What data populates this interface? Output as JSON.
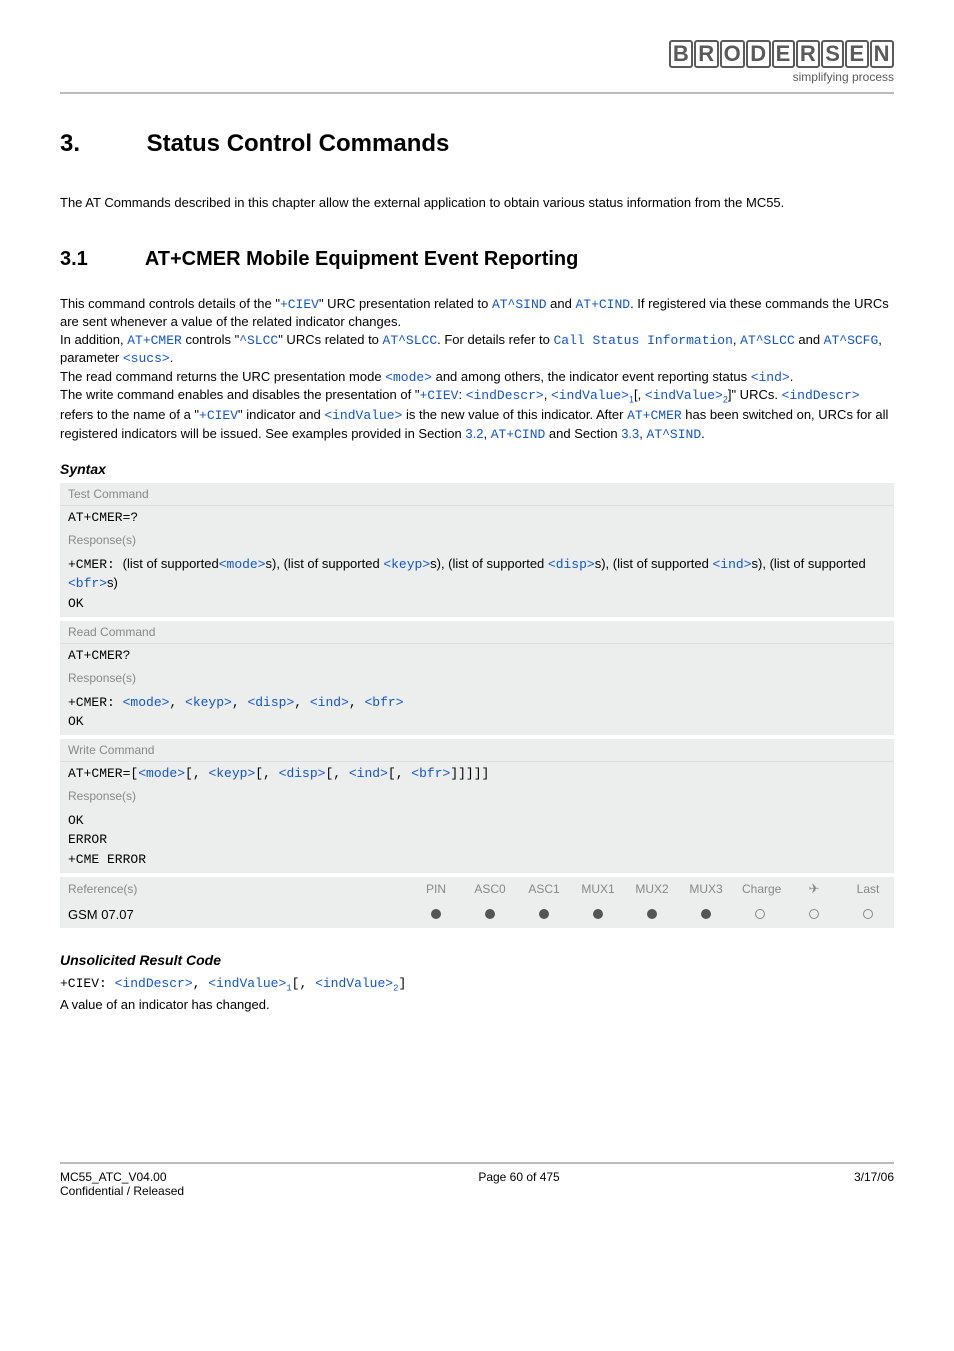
{
  "header": {
    "logo": "BRODERSEN",
    "tagline": "simplifying process"
  },
  "chapter": {
    "number": "3.",
    "title": "Status Control Commands"
  },
  "intro": "The AT Commands described in this chapter allow the external application to obtain various status information from the MC55.",
  "section": {
    "number": "3.1",
    "title": "AT+CMER   Mobile Equipment Event Reporting"
  },
  "body": {
    "t1a": "This command controls details of the \"",
    "l_ciev": "+CIEV",
    "t1b": "\" URC presentation related to ",
    "l_sind": "AT^SIND",
    "t1c": " and ",
    "l_cind": "AT+CIND",
    "t1d": ". If registered via these commands the URCs are sent whenever a value of the related indicator changes.",
    "t2a": "In addition, ",
    "l_cmer": "AT+CMER",
    "t2b": " controls \"",
    "l_slcc_urc": "^SLCC",
    "t2c": "\" URCs related to ",
    "l_slcc": "AT^SLCC",
    "t2d": ". For details refer to ",
    "l_callstatus": "Call Status Information",
    "t2e": ", ",
    "t2f": " and ",
    "l_scfg": "AT^SCFG",
    "t2g": ", parameter ",
    "l_sucs": "<sucs>",
    "t2h": ".",
    "t3a": "The read command returns the URC presentation mode ",
    "l_mode": "<mode>",
    "t3b": " and among others, the indicator event reporting status ",
    "l_ind": "<ind>",
    "t3c": ".",
    "t4a": "The write command enables and disables the presentation of \"",
    "t4b": ": ",
    "l_inddescr": "<indDescr>",
    "t4c": ", ",
    "l_indvalue": "<indValue>",
    "t4d": "[, ",
    "t4e": "]\" URCs. ",
    "t4f": " refers to the name of a \"",
    "t4g": "\" indicator and ",
    "t4h": " is the new value of this indicator. After ",
    "t4i": " has been switched on, URCs for all registered indicators will be issued. See examples provided in Section ",
    "l_32": "3.2",
    "t4j": ", ",
    "t4k": " and Section ",
    "l_33": "3.3",
    "t4l": ", ",
    "t4m": "."
  },
  "syntax_heading": "Syntax",
  "test": {
    "label": "Test Command",
    "command": "AT+CMER=?",
    "resp_label": "Response(s)",
    "r_prefix": "+CMER: ",
    "r_t1": "(list of supported",
    "r_t2": "s), (list of supported ",
    "r_keyp": "<keyp>",
    "r_t3": "s), (list of supported ",
    "r_disp": "<disp>",
    "r_t4": "s), (list of supported ",
    "r_t5": "s), (list of supported ",
    "r_bfr": "<bfr>",
    "r_t6": "s)",
    "r_ok": "OK"
  },
  "read": {
    "label": "Read Command",
    "command": "AT+CMER?",
    "resp_label": "Response(s)",
    "r_prefix": "+CMER: ",
    "r_ok": "OK"
  },
  "write": {
    "label": "Write Command",
    "cmd_prefix": "AT+CMER=[",
    "cmd_sep": "[, ",
    "cmd_end": "]]]]]",
    "resp_label": "Response(s)",
    "r_ok": "OK",
    "r_error": "ERROR",
    "r_cme": "+CME ERROR"
  },
  "ref": {
    "label": "Reference(s)",
    "cols": [
      "PIN",
      "ASC0",
      "ASC1",
      "MUX1",
      "MUX2",
      "MUX3",
      "Charge",
      "✈",
      "Last"
    ],
    "value": "GSM 07.07"
  },
  "urc": {
    "heading": "Unsolicited Result Code",
    "prefix": "+CIEV: ",
    "sep": ", ",
    "opt_open": "[, ",
    "opt_close": "]",
    "desc": "A value of an indicator has changed."
  },
  "footer": {
    "left1": "MC55_ATC_V04.00",
    "left2": "Confidential / Released",
    "center": "Page 60 of 475",
    "right": "3/17/06"
  }
}
